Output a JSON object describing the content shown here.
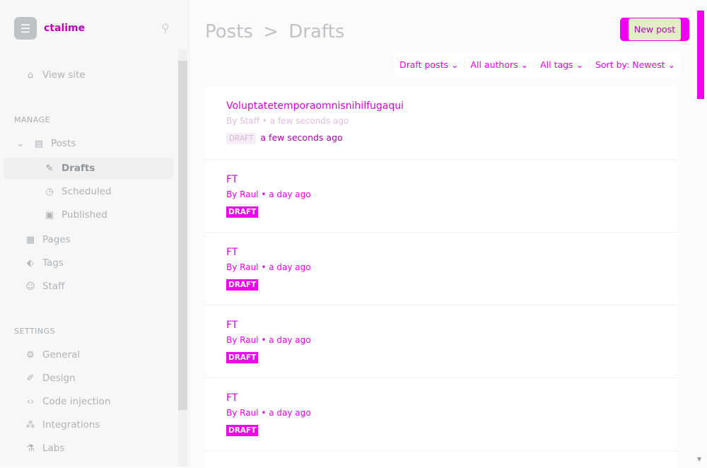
{
  "sidebar": {
    "site_name": "ctalime",
    "view_site": "View site",
    "manage_label": "MANAGE",
    "settings_label": "SETTINGS",
    "manage": [
      {
        "label": "Posts"
      },
      {
        "label": "Drafts"
      },
      {
        "label": "Scheduled"
      },
      {
        "label": "Published"
      },
      {
        "label": "Pages"
      },
      {
        "label": "Tags"
      },
      {
        "label": "Staff"
      }
    ],
    "settings": [
      {
        "label": "General"
      },
      {
        "label": "Design"
      },
      {
        "label": "Code injection"
      },
      {
        "label": "Integrations"
      },
      {
        "label": "Labs"
      }
    ]
  },
  "header": {
    "breadcrumb_root": "Posts",
    "separator": ">",
    "breadcrumb_current": "Drafts",
    "new_post": "New post"
  },
  "filters": {
    "type": "Draft posts",
    "author": "All authors",
    "tag": "All tags",
    "sort": "Sort by: Newest"
  },
  "posts": [
    {
      "title": "Voluptatetemporaomnisnihilfugaqui",
      "meta": "By Staff • a few seconds ago",
      "status": "DRAFT",
      "when": "a few seconds ago"
    },
    {
      "title": "FT",
      "meta": "By Raul • a day ago",
      "status": "DRAFT"
    },
    {
      "title": "FT",
      "meta": "By Raul • a day ago",
      "status": "DRAFT"
    },
    {
      "title": "FT",
      "meta": "By Raul • a day ago",
      "status": "DRAFT"
    },
    {
      "title": "FT",
      "meta": "By Raul • a day ago",
      "status": "DRAFT"
    }
  ]
}
